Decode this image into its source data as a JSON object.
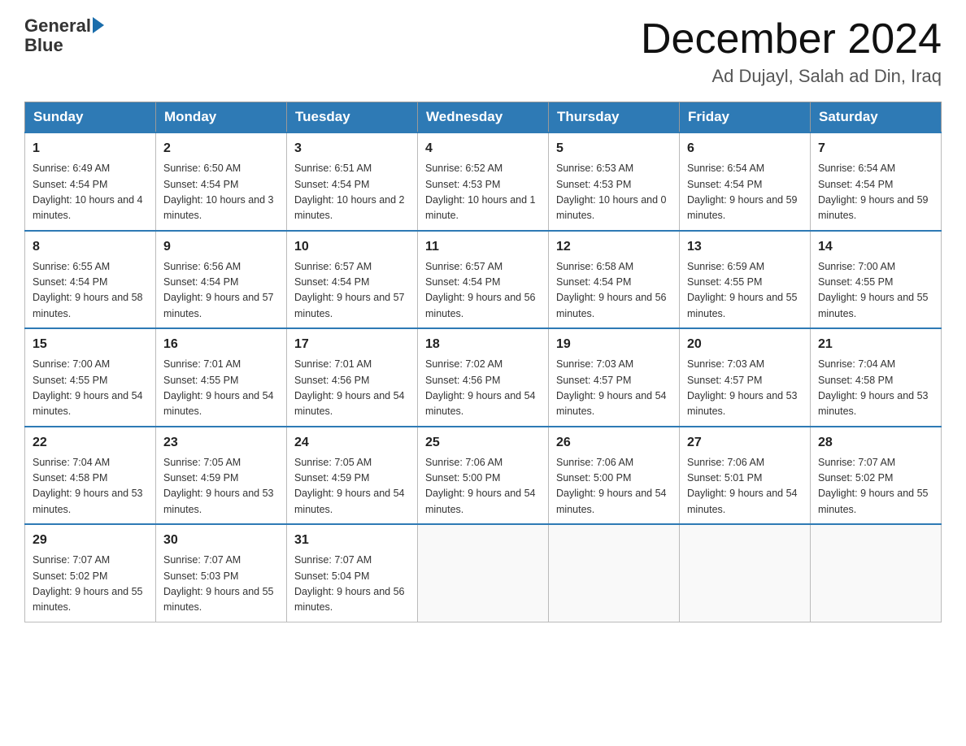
{
  "header": {
    "logo_general": "General",
    "logo_blue": "Blue",
    "month_title": "December 2024",
    "location": "Ad Dujayl, Salah ad Din, Iraq"
  },
  "days_of_week": [
    "Sunday",
    "Monday",
    "Tuesday",
    "Wednesday",
    "Thursday",
    "Friday",
    "Saturday"
  ],
  "weeks": [
    [
      {
        "day": "1",
        "sunrise": "6:49 AM",
        "sunset": "4:54 PM",
        "daylight": "10 hours and 4 minutes."
      },
      {
        "day": "2",
        "sunrise": "6:50 AM",
        "sunset": "4:54 PM",
        "daylight": "10 hours and 3 minutes."
      },
      {
        "day": "3",
        "sunrise": "6:51 AM",
        "sunset": "4:54 PM",
        "daylight": "10 hours and 2 minutes."
      },
      {
        "day": "4",
        "sunrise": "6:52 AM",
        "sunset": "4:53 PM",
        "daylight": "10 hours and 1 minute."
      },
      {
        "day": "5",
        "sunrise": "6:53 AM",
        "sunset": "4:53 PM",
        "daylight": "10 hours and 0 minutes."
      },
      {
        "day": "6",
        "sunrise": "6:54 AM",
        "sunset": "4:54 PM",
        "daylight": "9 hours and 59 minutes."
      },
      {
        "day": "7",
        "sunrise": "6:54 AM",
        "sunset": "4:54 PM",
        "daylight": "9 hours and 59 minutes."
      }
    ],
    [
      {
        "day": "8",
        "sunrise": "6:55 AM",
        "sunset": "4:54 PM",
        "daylight": "9 hours and 58 minutes."
      },
      {
        "day": "9",
        "sunrise": "6:56 AM",
        "sunset": "4:54 PM",
        "daylight": "9 hours and 57 minutes."
      },
      {
        "day": "10",
        "sunrise": "6:57 AM",
        "sunset": "4:54 PM",
        "daylight": "9 hours and 57 minutes."
      },
      {
        "day": "11",
        "sunrise": "6:57 AM",
        "sunset": "4:54 PM",
        "daylight": "9 hours and 56 minutes."
      },
      {
        "day": "12",
        "sunrise": "6:58 AM",
        "sunset": "4:54 PM",
        "daylight": "9 hours and 56 minutes."
      },
      {
        "day": "13",
        "sunrise": "6:59 AM",
        "sunset": "4:55 PM",
        "daylight": "9 hours and 55 minutes."
      },
      {
        "day": "14",
        "sunrise": "7:00 AM",
        "sunset": "4:55 PM",
        "daylight": "9 hours and 55 minutes."
      }
    ],
    [
      {
        "day": "15",
        "sunrise": "7:00 AM",
        "sunset": "4:55 PM",
        "daylight": "9 hours and 54 minutes."
      },
      {
        "day": "16",
        "sunrise": "7:01 AM",
        "sunset": "4:55 PM",
        "daylight": "9 hours and 54 minutes."
      },
      {
        "day": "17",
        "sunrise": "7:01 AM",
        "sunset": "4:56 PM",
        "daylight": "9 hours and 54 minutes."
      },
      {
        "day": "18",
        "sunrise": "7:02 AM",
        "sunset": "4:56 PM",
        "daylight": "9 hours and 54 minutes."
      },
      {
        "day": "19",
        "sunrise": "7:03 AM",
        "sunset": "4:57 PM",
        "daylight": "9 hours and 54 minutes."
      },
      {
        "day": "20",
        "sunrise": "7:03 AM",
        "sunset": "4:57 PM",
        "daylight": "9 hours and 53 minutes."
      },
      {
        "day": "21",
        "sunrise": "7:04 AM",
        "sunset": "4:58 PM",
        "daylight": "9 hours and 53 minutes."
      }
    ],
    [
      {
        "day": "22",
        "sunrise": "7:04 AM",
        "sunset": "4:58 PM",
        "daylight": "9 hours and 53 minutes."
      },
      {
        "day": "23",
        "sunrise": "7:05 AM",
        "sunset": "4:59 PM",
        "daylight": "9 hours and 53 minutes."
      },
      {
        "day": "24",
        "sunrise": "7:05 AM",
        "sunset": "4:59 PM",
        "daylight": "9 hours and 54 minutes."
      },
      {
        "day": "25",
        "sunrise": "7:06 AM",
        "sunset": "5:00 PM",
        "daylight": "9 hours and 54 minutes."
      },
      {
        "day": "26",
        "sunrise": "7:06 AM",
        "sunset": "5:00 PM",
        "daylight": "9 hours and 54 minutes."
      },
      {
        "day": "27",
        "sunrise": "7:06 AM",
        "sunset": "5:01 PM",
        "daylight": "9 hours and 54 minutes."
      },
      {
        "day": "28",
        "sunrise": "7:07 AM",
        "sunset": "5:02 PM",
        "daylight": "9 hours and 55 minutes."
      }
    ],
    [
      {
        "day": "29",
        "sunrise": "7:07 AM",
        "sunset": "5:02 PM",
        "daylight": "9 hours and 55 minutes."
      },
      {
        "day": "30",
        "sunrise": "7:07 AM",
        "sunset": "5:03 PM",
        "daylight": "9 hours and 55 minutes."
      },
      {
        "day": "31",
        "sunrise": "7:07 AM",
        "sunset": "5:04 PM",
        "daylight": "9 hours and 56 minutes."
      },
      null,
      null,
      null,
      null
    ]
  ]
}
